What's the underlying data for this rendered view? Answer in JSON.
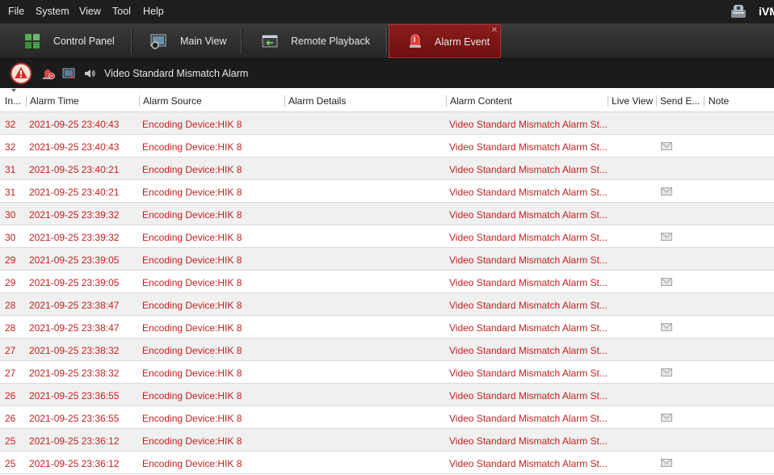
{
  "menu": {
    "items": [
      {
        "label": "File",
        "name": "menu-file"
      },
      {
        "label": "System",
        "name": "menu-system"
      },
      {
        "label": "View",
        "name": "menu-view"
      },
      {
        "label": "Tool",
        "name": "menu-tool"
      },
      {
        "label": "Help",
        "name": "menu-help"
      }
    ],
    "logo_text": "iVM"
  },
  "tabs": [
    {
      "label": "Control Panel",
      "icon": "control-panel-icon",
      "active": false
    },
    {
      "label": "Main View",
      "icon": "main-view-icon",
      "active": false
    },
    {
      "label": "Remote Playback",
      "icon": "remote-playback-icon",
      "active": false
    },
    {
      "label": "Alarm Event",
      "icon": "alarm-event-icon",
      "active": true
    }
  ],
  "alarm_toolbar": {
    "title": "Video Standard Mismatch Alarm",
    "icons": [
      "alarm-warning-icon",
      "clear-alarm-icon",
      "alarm-view-icon",
      "sound-icon"
    ]
  },
  "table": {
    "columns": [
      "In...",
      "Alarm Time",
      "Alarm Source",
      "Alarm Details",
      "Alarm Content",
      "Live View",
      "Send E...",
      "Note"
    ],
    "rows": [
      {
        "index": "32",
        "time": "2021-09-25 23:40:43",
        "source": "Encoding Device:HIK 8",
        "details": "",
        "content": "Video Standard Mismatch Alarm St...",
        "email": false
      },
      {
        "index": "32",
        "time": "2021-09-25 23:40:43",
        "source": "Encoding Device:HIK 8",
        "details": "",
        "content": "Video Standard Mismatch Alarm St...",
        "email": true
      },
      {
        "index": "31",
        "time": "2021-09-25 23:40:21",
        "source": "Encoding Device:HIK 8",
        "details": "",
        "content": "Video Standard Mismatch Alarm St...",
        "email": false
      },
      {
        "index": "31",
        "time": "2021-09-25 23:40:21",
        "source": "Encoding Device:HIK 8",
        "details": "",
        "content": "Video Standard Mismatch Alarm St...",
        "email": true
      },
      {
        "index": "30",
        "time": "2021-09-25 23:39:32",
        "source": "Encoding Device:HIK 8",
        "details": "",
        "content": "Video Standard Mismatch Alarm St...",
        "email": false
      },
      {
        "index": "30",
        "time": "2021-09-25 23:39:32",
        "source": "Encoding Device:HIK 8",
        "details": "",
        "content": "Video Standard Mismatch Alarm St...",
        "email": true
      },
      {
        "index": "29",
        "time": "2021-09-25 23:39:05",
        "source": "Encoding Device:HIK 8",
        "details": "",
        "content": "Video Standard Mismatch Alarm St...",
        "email": false
      },
      {
        "index": "29",
        "time": "2021-09-25 23:39:05",
        "source": "Encoding Device:HIK 8",
        "details": "",
        "content": "Video Standard Mismatch Alarm St...",
        "email": true
      },
      {
        "index": "28",
        "time": "2021-09-25 23:38:47",
        "source": "Encoding Device:HIK 8",
        "details": "",
        "content": "Video Standard Mismatch Alarm St...",
        "email": false
      },
      {
        "index": "28",
        "time": "2021-09-25 23:38:47",
        "source": "Encoding Device:HIK 8",
        "details": "",
        "content": "Video Standard Mismatch Alarm St...",
        "email": true
      },
      {
        "index": "27",
        "time": "2021-09-25 23:38:32",
        "source": "Encoding Device:HIK 8",
        "details": "",
        "content": "Video Standard Mismatch Alarm St...",
        "email": false
      },
      {
        "index": "27",
        "time": "2021-09-25 23:38:32",
        "source": "Encoding Device:HIK 8",
        "details": "",
        "content": "Video Standard Mismatch Alarm St...",
        "email": true
      },
      {
        "index": "26",
        "time": "2021-09-25 23:36:55",
        "source": "Encoding Device:HIK 8",
        "details": "",
        "content": "Video Standard Mismatch Alarm St...",
        "email": false
      },
      {
        "index": "26",
        "time": "2021-09-25 23:36:55",
        "source": "Encoding Device:HIK 8",
        "details": "",
        "content": "Video Standard Mismatch Alarm St...",
        "email": true
      },
      {
        "index": "25",
        "time": "2021-09-25 23:36:12",
        "source": "Encoding Device:HIK 8",
        "details": "",
        "content": "Video Standard Mismatch Alarm St...",
        "email": false
      },
      {
        "index": "25",
        "time": "2021-09-25 23:36:12",
        "source": "Encoding Device:HIK 8",
        "details": "",
        "content": "Video Standard Mismatch Alarm St...",
        "email": true
      }
    ]
  },
  "colors": {
    "alarm_text": "#c41f1f",
    "active_tab": "#7d1515",
    "menubar_bg": "#1e1e1e"
  }
}
